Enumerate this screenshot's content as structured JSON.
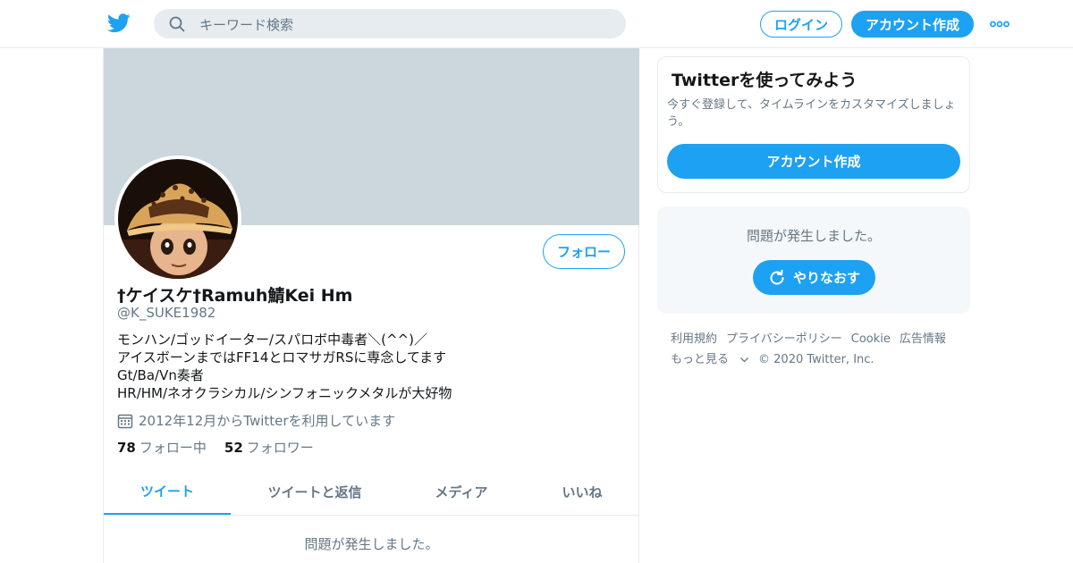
{
  "header": {
    "logo": "twitter-bird-icon",
    "search_placeholder": "キーワード検索",
    "login_label": "ログイン",
    "signup_label": "アカウント作成",
    "more_icon": "more-dots-icon"
  },
  "profile": {
    "display_name": "†ケイスケ†Ramuh鯖Kei Hm",
    "handle": "@K_SUKE1982",
    "follow_label": "フォロー",
    "bio_lines": [
      "モンハン/ゴッドイーター/スパロボ中毒者＼(^^)／",
      "アイスボーンまではFF14とロマサガRSに専念してます",
      "Gt/Ba/Vn奏者",
      "HR/HM/ネオクラシカル/シンフォニックメタルが大好物"
    ],
    "joined": "2012年12月からTwitterを利用しています",
    "following_count": "78",
    "following_label": "フォロー中",
    "followers_count": "52",
    "followers_label": "フォロワー"
  },
  "tabs": [
    {
      "label": "ツイート",
      "active": true
    },
    {
      "label": "ツイートと返信",
      "active": false
    },
    {
      "label": "メディア",
      "active": false
    },
    {
      "label": "いいね",
      "active": false
    }
  ],
  "main_error": "問題が発生しました。",
  "sidebar": {
    "signup_title": "Twitterを使ってみよう",
    "signup_desc": "今すぐ登録して、タイムラインをカスタマイズしましょう。",
    "signup_button": "アカウント作成",
    "error_message": "問題が発生しました。",
    "retry_label": "やりなおす"
  },
  "footer": {
    "links": [
      "利用規約",
      "プライバシーポリシー",
      "Cookie",
      "広告情報"
    ],
    "more_label": "もっと見る",
    "copyright": "© 2020 Twitter, Inc."
  },
  "colors": {
    "accent": "#1da1f2",
    "banner": "#ccd6dd",
    "muted_text": "#657786",
    "border": "#e6ecf0"
  }
}
